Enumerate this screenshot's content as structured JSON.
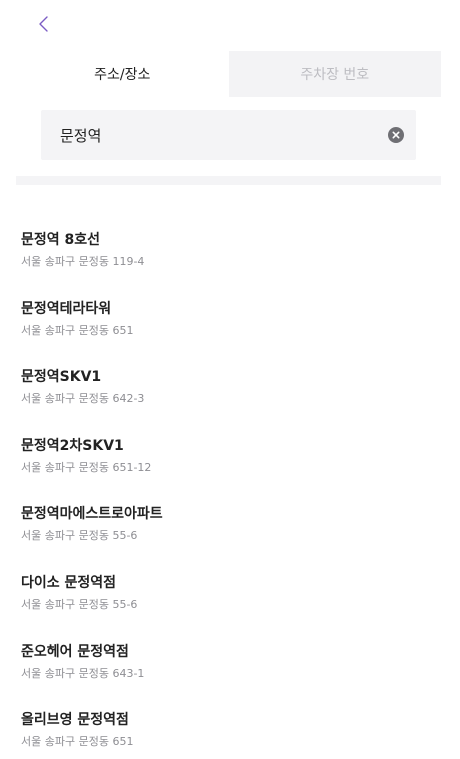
{
  "header": {
    "back_icon": "chevron-left-icon",
    "accent_color": "#7b5cc4"
  },
  "tabs": [
    {
      "label": "주소/장소",
      "active": true
    },
    {
      "label": "주차장 번호",
      "active": false
    }
  ],
  "search": {
    "value": "문정역",
    "clear_icon": "clear-circle-icon"
  },
  "results": [
    {
      "title": "문정역 8호선",
      "address": "서울 송파구 문정동 119-4"
    },
    {
      "title": "문정역테라타워",
      "address": "서울 송파구 문정동 651"
    },
    {
      "title": "문정역SKV1",
      "address": "서울 송파구 문정동 642-3"
    },
    {
      "title": "문정역2차SKV1",
      "address": "서울 송파구 문정동 651-12"
    },
    {
      "title": "문정역마에스트로아파트",
      "address": "서울 송파구 문정동 55-6"
    },
    {
      "title": "다이소 문정역점",
      "address": "서울 송파구 문정동 55-6"
    },
    {
      "title": "준오헤어 문정역점",
      "address": "서울 송파구 문정동 643-1"
    },
    {
      "title": "올리브영 문정역점",
      "address": "서울 송파구 문정동 651"
    }
  ]
}
